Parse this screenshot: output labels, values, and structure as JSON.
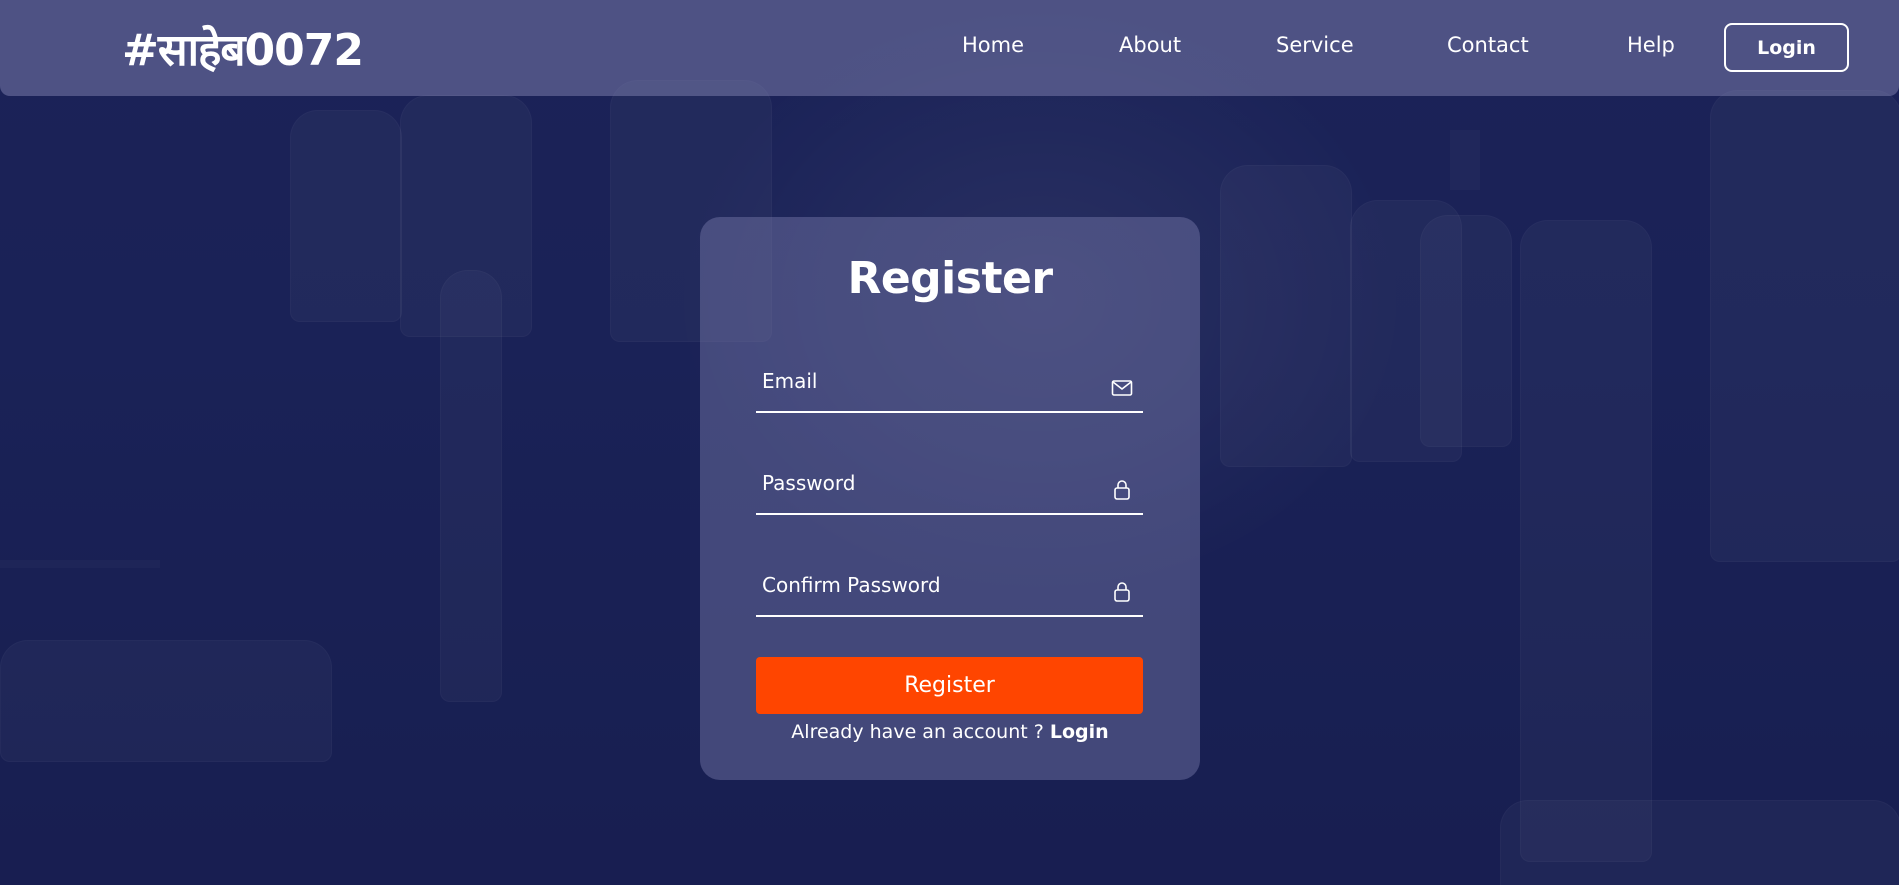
{
  "header": {
    "brand": "#साहेब0072",
    "nav": [
      {
        "label": "Home"
      },
      {
        "label": "About"
      },
      {
        "label": "Service"
      },
      {
        "label": "Contact"
      },
      {
        "label": "Help"
      }
    ],
    "login_label": "Login"
  },
  "form": {
    "title": "Register",
    "email": {
      "placeholder": "Email",
      "value": "",
      "icon": "envelope-icon"
    },
    "password": {
      "placeholder": "Password",
      "value": "",
      "icon": "lock-icon"
    },
    "confirm_password": {
      "placeholder": "Confirm Password",
      "value": "",
      "icon": "lock-icon"
    },
    "submit_label": "Register",
    "footer_text": "Already have an account ? ",
    "footer_link": "Login"
  },
  "colors": {
    "accent": "#ff4500",
    "background": "#1a2150",
    "text": "#ffffff"
  }
}
